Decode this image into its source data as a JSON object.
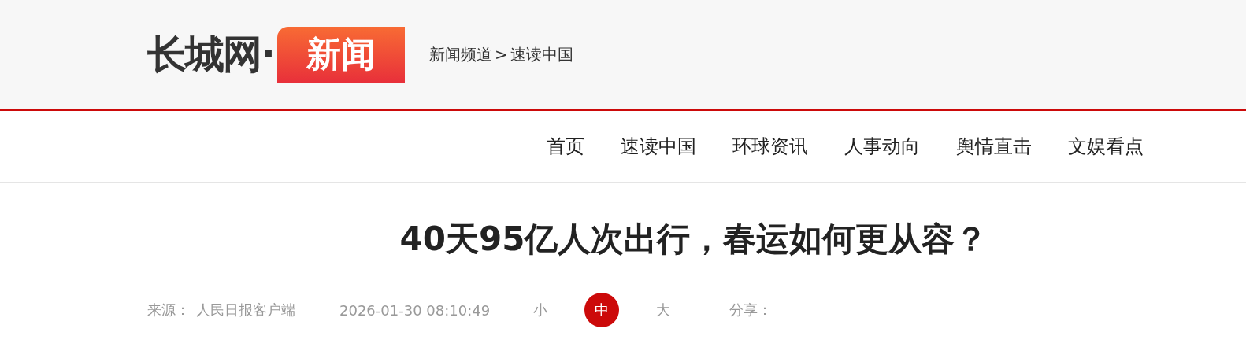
{
  "header": {
    "logo_text": "长城网·",
    "logo_badge": "新闻",
    "breadcrumb": [
      {
        "label": "新闻频道"
      },
      {
        "label": "速读中国"
      }
    ],
    "separator": ">"
  },
  "nav": [
    {
      "label": "首页"
    },
    {
      "label": "速读中国"
    },
    {
      "label": "环球资讯"
    },
    {
      "label": "人事动向"
    },
    {
      "label": "舆情直击"
    },
    {
      "label": "文娱看点"
    }
  ],
  "article": {
    "title": "40天95亿人次出行，春运如何更从容？",
    "source_label": "来源：",
    "source": "人民日报客户端",
    "date": "2026-01-30 08:10:49",
    "font_sizes": [
      {
        "label": "小",
        "selected": false
      },
      {
        "label": "中",
        "selected": true
      },
      {
        "label": "大",
        "selected": false
      }
    ],
    "share_label": "分享："
  }
}
